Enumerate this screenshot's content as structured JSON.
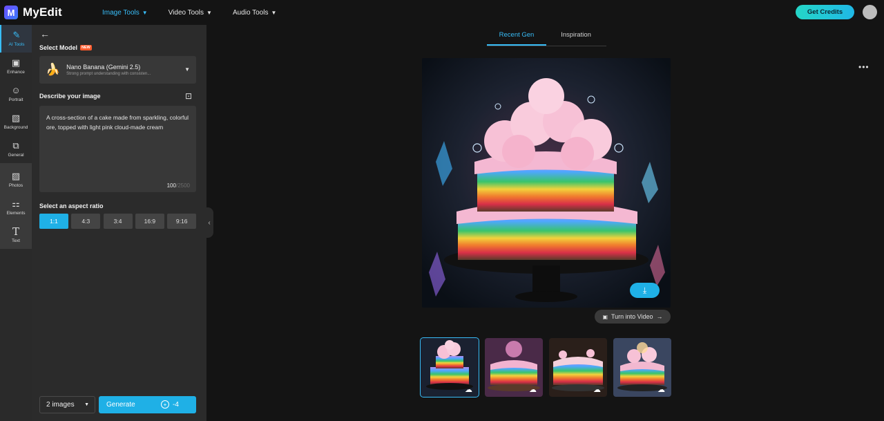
{
  "brand": {
    "logo_letter": "M",
    "name": "MyEdit"
  },
  "nav": [
    {
      "label": "Image Tools",
      "active": true
    },
    {
      "label": "Video Tools",
      "active": false
    },
    {
      "label": "Audio Tools",
      "active": false
    }
  ],
  "header": {
    "credits_label": "Get Credits"
  },
  "rail": {
    "items": [
      {
        "label": "AI Tools",
        "icon": "magic-wand-icon"
      },
      {
        "label": "Enhance",
        "icon": "image-icon"
      },
      {
        "label": "Portrait",
        "icon": "portrait-icon"
      },
      {
        "label": "Background",
        "icon": "background-icon"
      },
      {
        "label": "General",
        "icon": "copy-icon"
      },
      {
        "label": "Photos",
        "icon": "photo-icon"
      },
      {
        "label": "Elements",
        "icon": "shapes-icon"
      },
      {
        "label": "Text",
        "icon": "text-icon"
      }
    ]
  },
  "panel": {
    "select_model_label": "Select Model",
    "new_badge": "NEW",
    "model": {
      "name": "Nano Banana (Gemini 2.5)",
      "description": "Strong prompt understanding with consisten..."
    },
    "describe_label": "Describe your image",
    "prompt": "A cross-section of a cake made from sparkling, colorful ore, topped with light pink cloud-made cream",
    "char_count": "100",
    "char_max": "/2500",
    "aspect_label": "Select an aspect ratio",
    "ratios": [
      "1:1",
      "4:3",
      "3:4",
      "16:9",
      "9:16"
    ],
    "selected_ratio": "1:1",
    "image_count": "2 images",
    "generate_label": "Generate",
    "generate_cost": "-4"
  },
  "tabs": [
    {
      "label": "Recent Gen",
      "active": true
    },
    {
      "label": "Inspiration",
      "active": false
    }
  ],
  "viewer": {
    "video_label": "Turn into Video"
  },
  "colors": {
    "accent": "#38bdf8",
    "credits_gradient_start": "#25d6c7",
    "credits_gradient_end": "#1fb8e6",
    "new_badge": "#ff5a2c"
  }
}
